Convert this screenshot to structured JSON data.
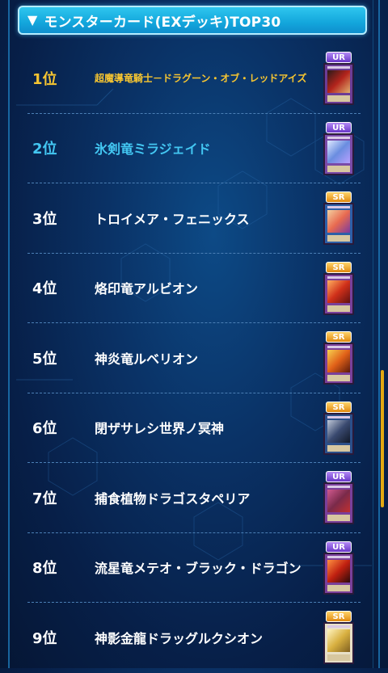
{
  "header": {
    "arrow": "▼",
    "title": "モンスターカード(EXデッキ)TOP30"
  },
  "colors": {
    "gold": "#f6c531",
    "cyan": "#43c7f2",
    "header_bg": "#1aa8df",
    "ur_badge": "#8b5ce0",
    "sr_badge": "#f0a020"
  },
  "entries": [
    {
      "rank": "1位",
      "name": "超魔導竜騎士－ドラグーン・オブ・レッドアイズ",
      "rarity": "UR"
    },
    {
      "rank": "2位",
      "name": "氷剣竜ミラジェイド",
      "rarity": "UR"
    },
    {
      "rank": "3位",
      "name": "トロイメア・フェニックス",
      "rarity": "SR"
    },
    {
      "rank": "4位",
      "name": "烙印竜アルビオン",
      "rarity": "SR"
    },
    {
      "rank": "5位",
      "name": "神炎竜ルベリオン",
      "rarity": "SR"
    },
    {
      "rank": "6位",
      "name": "閉ザサレシ世界ノ冥神",
      "rarity": "SR"
    },
    {
      "rank": "7位",
      "name": "捕食植物ドラゴスタペリア",
      "rarity": "UR"
    },
    {
      "rank": "8位",
      "name": "流星竜メテオ・ブラック・ドラゴン",
      "rarity": "UR"
    },
    {
      "rank": "9位",
      "name": "神影金龍ドラッグルクシオン",
      "rarity": "SR"
    }
  ]
}
